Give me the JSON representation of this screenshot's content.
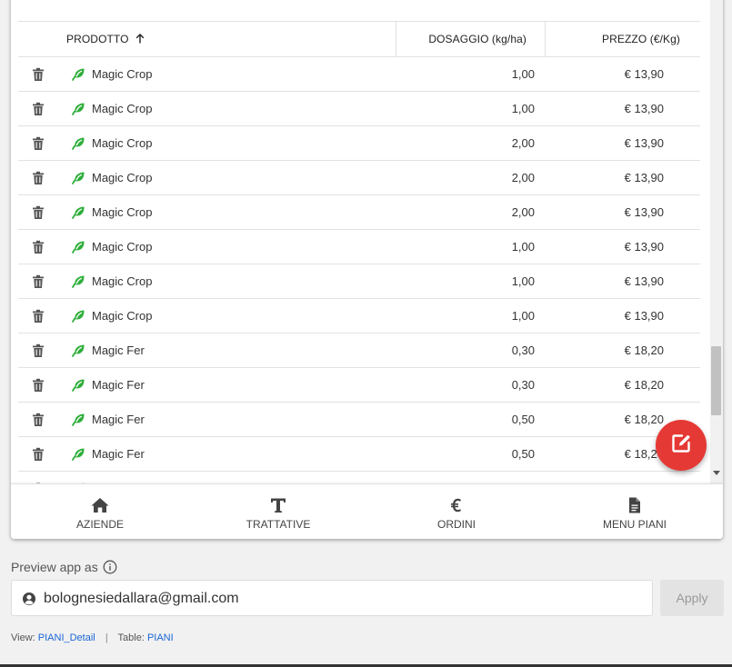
{
  "table": {
    "headers": {
      "prodotto": "PRODOTTO",
      "dosaggio": "DOSAGGIO (kg/ha)",
      "prezzo": "PREZZO (€/Kg)"
    },
    "rows": [
      {
        "name": "Magic Crop",
        "dose": "1,00",
        "price": "€ 13,90"
      },
      {
        "name": "Magic Crop",
        "dose": "1,00",
        "price": "€ 13,90"
      },
      {
        "name": "Magic Crop",
        "dose": "2,00",
        "price": "€ 13,90"
      },
      {
        "name": "Magic Crop",
        "dose": "2,00",
        "price": "€ 13,90"
      },
      {
        "name": "Magic Crop",
        "dose": "2,00",
        "price": "€ 13,90"
      },
      {
        "name": "Magic Crop",
        "dose": "1,00",
        "price": "€ 13,90"
      },
      {
        "name": "Magic Crop",
        "dose": "1,00",
        "price": "€ 13,90"
      },
      {
        "name": "Magic Crop",
        "dose": "1,00",
        "price": "€ 13,90"
      },
      {
        "name": "Magic Fer",
        "dose": "0,30",
        "price": "€ 18,20"
      },
      {
        "name": "Magic Fer",
        "dose": "0,30",
        "price": "€ 18,20"
      },
      {
        "name": "Magic Fer",
        "dose": "0,50",
        "price": "€ 18,20"
      },
      {
        "name": "Magic Fer",
        "dose": "0,50",
        "price": "€ 18,20"
      }
    ]
  },
  "nav": {
    "items": [
      {
        "label": "AZIENDE",
        "icon": "home-icon"
      },
      {
        "label": "TRATTATIVE",
        "icon": "text-t-icon"
      },
      {
        "label": "ORDINI",
        "icon": "euro-icon"
      },
      {
        "label": "MENU PIANI",
        "icon": "document-icon"
      }
    ]
  },
  "preview": {
    "label": "Preview app as",
    "email": "bolognesiedallara@gmail.com",
    "apply_label": "Apply"
  },
  "footer": {
    "view_label": "View:",
    "view_value": "PIANI_Detail",
    "separator": "|",
    "table_label": "Table:",
    "table_value": "PIANI"
  },
  "colors": {
    "fab": "#e53935",
    "leaf": "#2eae3a",
    "link": "#1a65d6"
  }
}
